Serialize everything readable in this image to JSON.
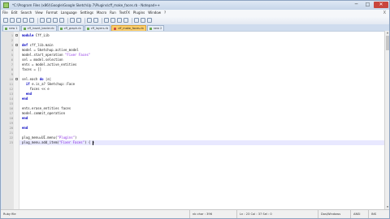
{
  "window": {
    "title": "*C:\\Program Files (x86)\\Google\\Google SketchUp 7\\Plugins\\cff_make_faces.rb - Notepad++",
    "controls": {
      "minimize": "─",
      "maximize": "□",
      "close": "✕"
    }
  },
  "menu": {
    "items": [
      "File",
      "Edit",
      "Search",
      "View",
      "Format",
      "Language",
      "Settings",
      "Macro",
      "Run",
      "TextFX",
      "Plugins",
      "Window",
      "?"
    ],
    "close_x": "X"
  },
  "toolbar": {
    "icons": [
      "new-icon",
      "open-icon",
      "save-icon",
      "save-all-icon",
      "close-icon",
      "print-icon",
      "cut-icon",
      "copy-icon",
      "paste-icon",
      "undo-icon",
      "redo-icon",
      "find-icon",
      "replace-icon",
      "zoom-in-icon",
      "zoom-out-icon",
      "wrap-icon",
      "indent-icon",
      "macro-record-icon",
      "macro-stop-icon",
      "macro-play-icon"
    ]
  },
  "tabs": [
    {
      "label": "new 1",
      "active": false
    },
    {
      "label": "cff_insert_bezier.rb",
      "active": false
    },
    {
      "label": "cff_graph.rb",
      "active": false
    },
    {
      "label": "cff_layers.rb",
      "active": false
    },
    {
      "label": "cff_make_faces.rb",
      "active": true
    },
    {
      "label": "new 2",
      "active": false
    }
  ],
  "editor": {
    "lines": [
      {
        "n": "1",
        "text": "module Cff_Lib",
        "fold": true
      },
      {
        "n": "2",
        "text": ""
      },
      {
        "n": "3",
        "text": "def cff_lib.main",
        "fold": true
      },
      {
        "n": "4",
        "text": "model = Sketchup.active_model"
      },
      {
        "n": "5",
        "text": "model.start_operation \"Fixer Faces\""
      },
      {
        "n": "6",
        "text": "sel = model.selection"
      },
      {
        "n": "7",
        "text": "ents = model.active_entities"
      },
      {
        "n": "8",
        "text": "faces = []"
      },
      {
        "n": "9",
        "text": ""
      },
      {
        "n": "10",
        "text": "sel.each do |e|",
        "fold": true
      },
      {
        "n": "11",
        "text": "  if e.is_a? Sketchup::Face"
      },
      {
        "n": "12",
        "text": "    faces << e"
      },
      {
        "n": "13",
        "text": "  end"
      },
      {
        "n": "14",
        "text": "end"
      },
      {
        "n": "15",
        "text": ""
      },
      {
        "n": "16",
        "text": "ents.erase_entities faces"
      },
      {
        "n": "17",
        "text": "model.commit_operation"
      },
      {
        "n": "18",
        "text": "end"
      },
      {
        "n": "19",
        "text": ""
      },
      {
        "n": "20",
        "text": "end"
      },
      {
        "n": "21",
        "text": ""
      },
      {
        "n": "22",
        "text": "plug_menu=UI.menu(\"Plugins\")"
      },
      {
        "n": "23",
        "text": "plug_menu.add_item(\"Fixer Faces\") { }"
      }
    ],
    "current_line": 23
  },
  "status": {
    "file_type": "Ruby file",
    "length": "nb char : 396",
    "position": "Ln : 23    Col : 37    Sel : 0",
    "eol": "Dos\\Windows",
    "encoding": "ANSI",
    "mode": "INS"
  }
}
